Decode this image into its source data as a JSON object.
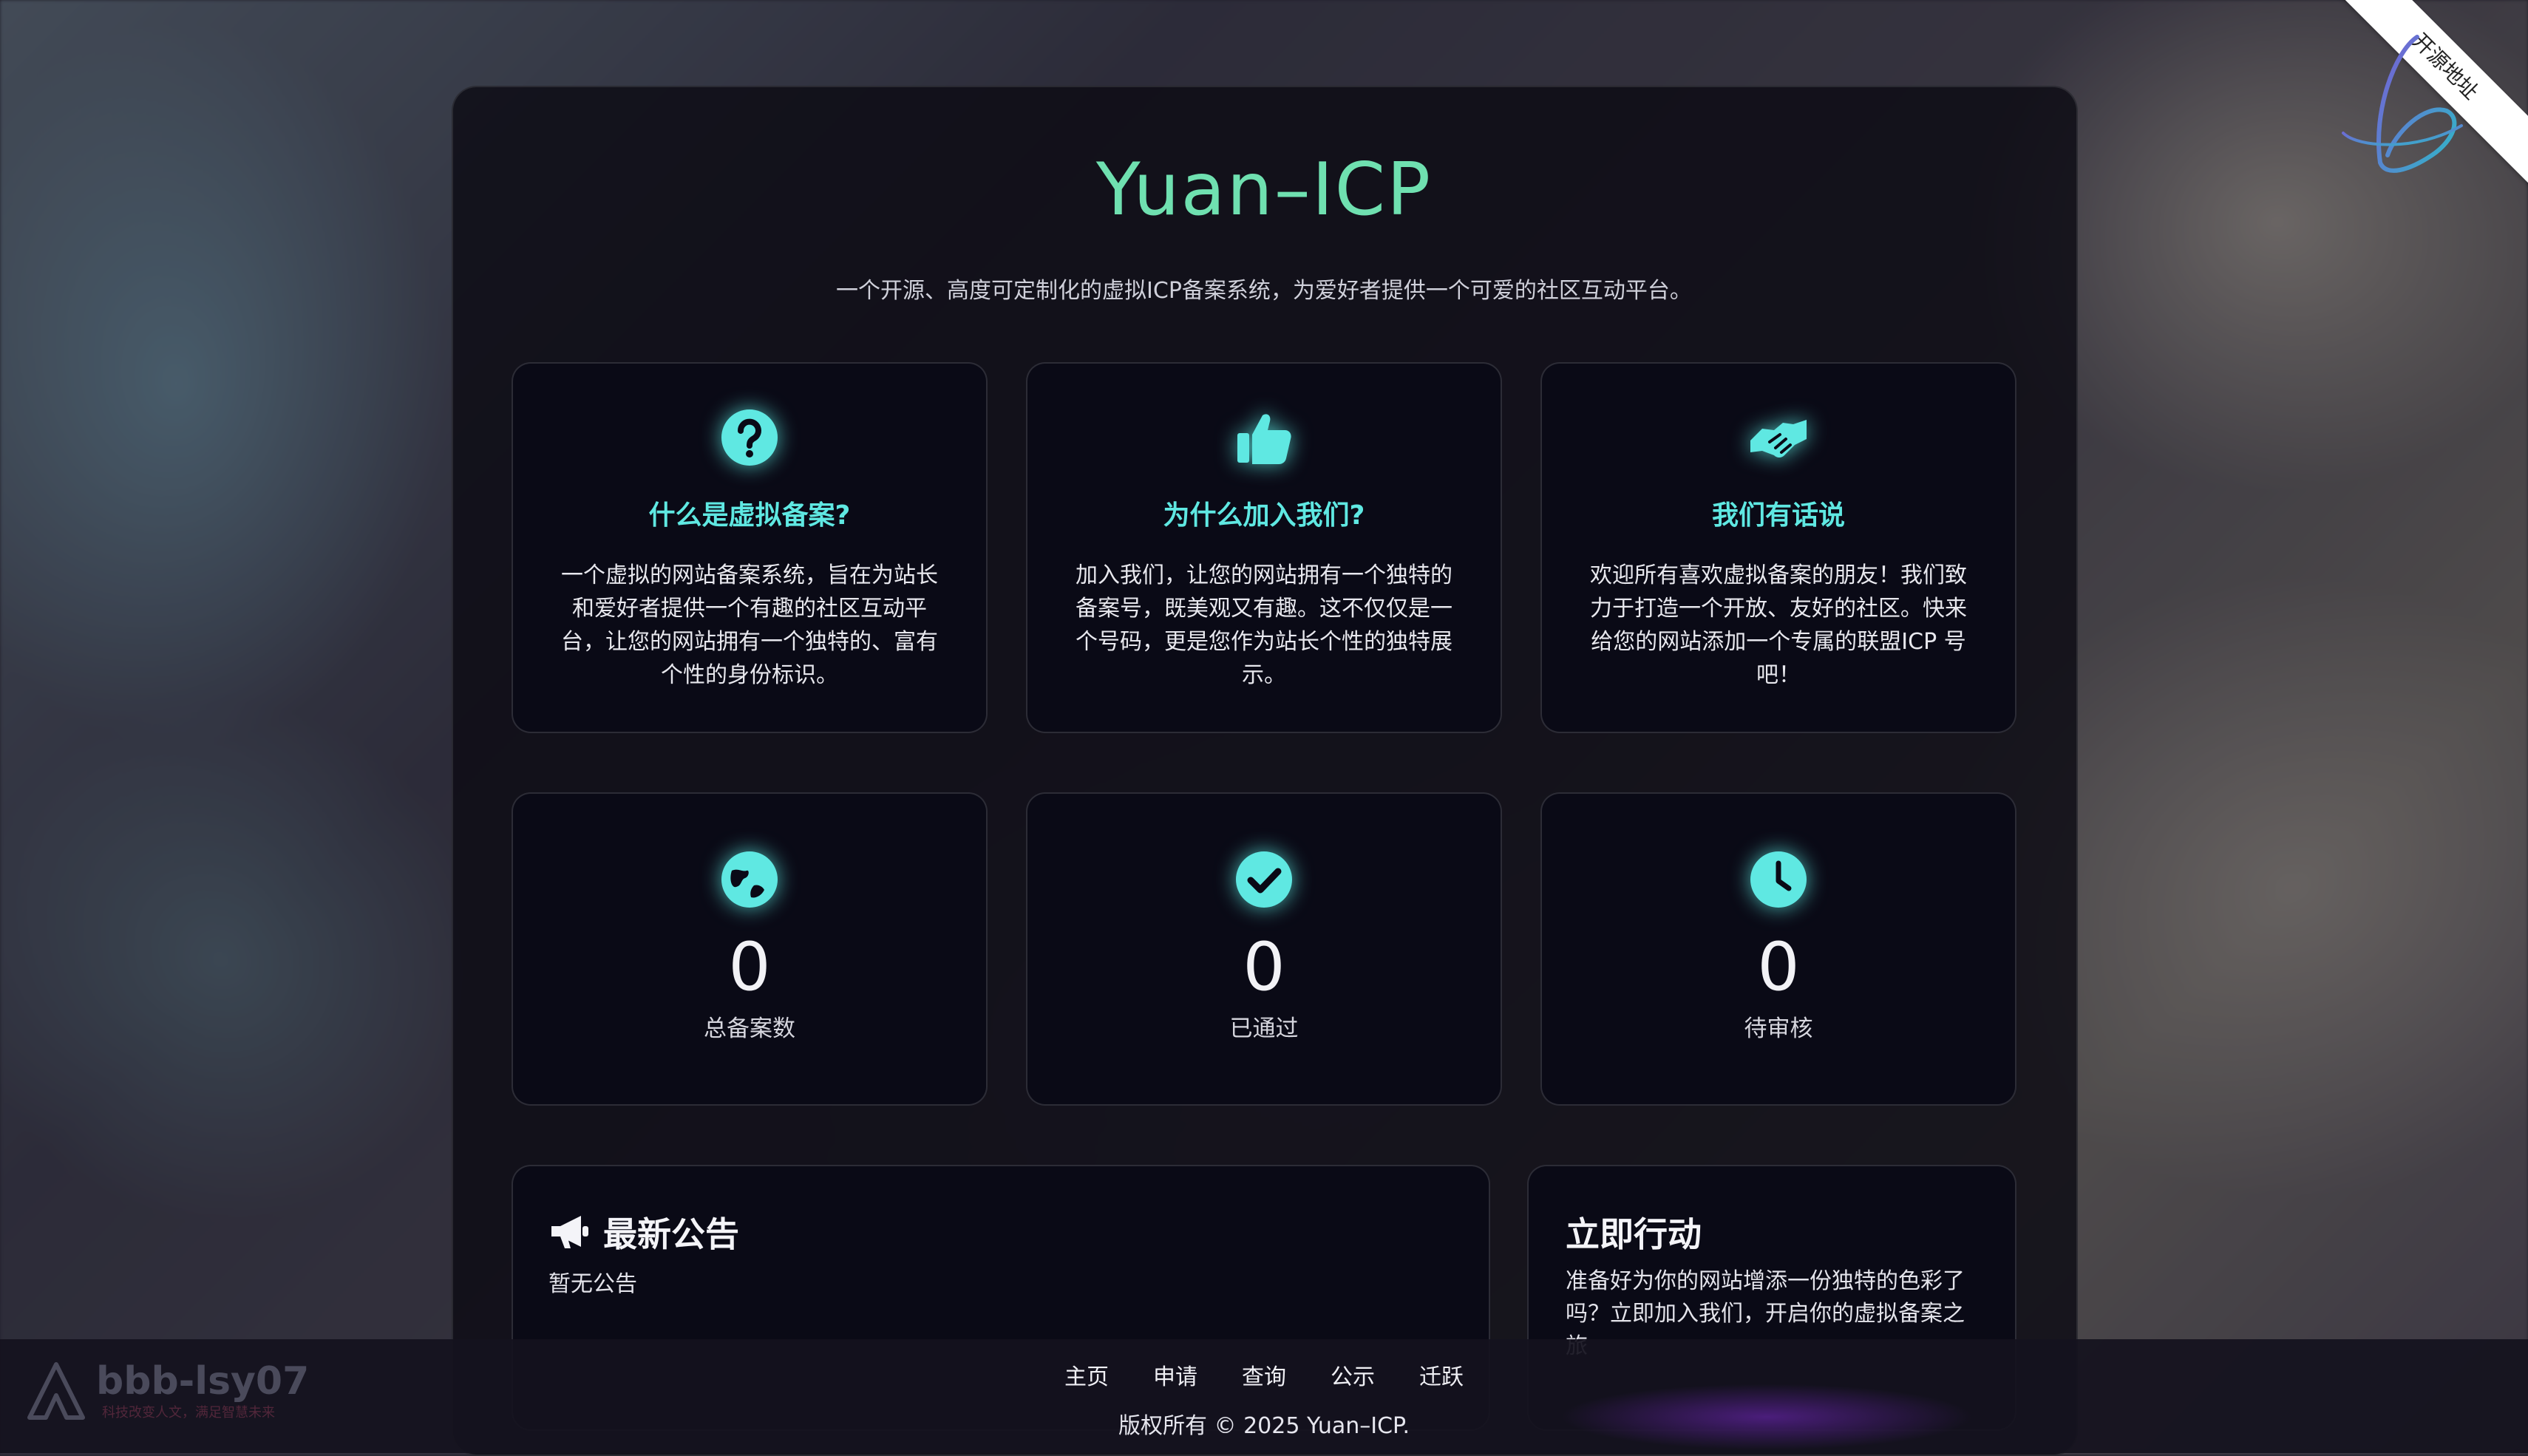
{
  "header": {
    "title": "Yuan–ICP",
    "subtitle": "一个开源、高度可定制化的虚拟ICP备案系统，为爱好者提供一个可爱的社区互动平台。"
  },
  "ribbon": {
    "label": "开源地址"
  },
  "features": [
    {
      "icon": "question-circle-icon",
      "title": "什么是虚拟备案?",
      "text": "一个虚拟的网站备案系统，旨在为站长和爱好者提供一个有趣的社区互动平台，让您的网站拥有一个独特的、富有个性的身份标识。"
    },
    {
      "icon": "thumbs-up-icon",
      "title": "为什么加入我们?",
      "text": "加入我们，让您的网站拥有一个独特的备案号，既美观又有趣。这不仅仅是一个号码，更是您作为站长个性的独特展示。"
    },
    {
      "icon": "handshake-icon",
      "title": "我们有话说",
      "text": "欢迎所有喜欢虚拟备案的朋友！我们致力于打造一个开放、友好的社区。快来给您的网站添加一个专属的联盟ICP 号吧！"
    }
  ],
  "stats": [
    {
      "icon": "globe-icon",
      "value": "0",
      "label": "总备案数"
    },
    {
      "icon": "check-circle-icon",
      "value": "0",
      "label": "已通过"
    },
    {
      "icon": "clock-icon",
      "value": "0",
      "label": "待审核"
    }
  ],
  "announcement": {
    "icon": "megaphone-icon",
    "title": "最新公告",
    "text": "暂无公告"
  },
  "action": {
    "title": "立即行动",
    "text": "准备好为你的网站增添一份独特的色彩了吗？立即加入我们，开启你的虚拟备案之旅"
  },
  "footer": {
    "nav": [
      "主页",
      "申请",
      "查询",
      "公示",
      "迁跃"
    ],
    "copyright": "版权所有 © 2025 Yuan–ICP."
  },
  "watermark": {
    "brand": "bbb-lsy07",
    "tagline": "科技改变人文，满足智慧未来"
  },
  "colors": {
    "accent_title": "#6fe0b0",
    "accent_icon": "#5fe8e2",
    "card_bg": "#0a0a16"
  }
}
